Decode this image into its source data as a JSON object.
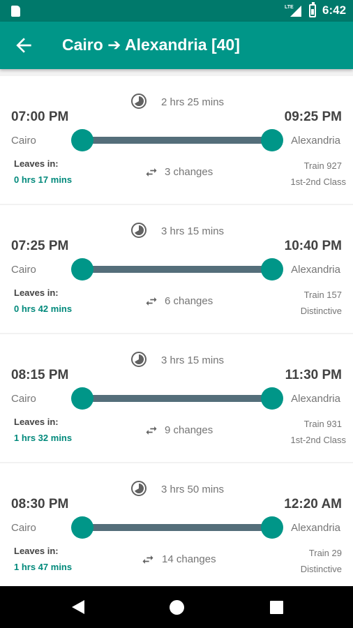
{
  "status_bar": {
    "time": "6:42",
    "network": "LTE"
  },
  "app_bar": {
    "title": "Cairo ➔ Alexandria [40]",
    "back_icon": "arrow-back-icon"
  },
  "trips": [
    {
      "duration": "2 hrs 25 mins",
      "departure_time": "07:00 PM",
      "arrival_time": "09:25 PM",
      "from": "Cairo",
      "to": "Alexandria",
      "leaves_in_label": "Leaves in:",
      "leaves_in": "0 hrs 17 mins",
      "changes": "3 changes",
      "train": "Train 927",
      "class": "1st-2nd Class"
    },
    {
      "duration": "3 hrs 15 mins",
      "departure_time": "07:25 PM",
      "arrival_time": "10:40 PM",
      "from": "Cairo",
      "to": "Alexandria",
      "leaves_in_label": "Leaves in:",
      "leaves_in": "0 hrs 42 mins",
      "changes": "6 changes",
      "train": "Train 157",
      "class": "Distinctive"
    },
    {
      "duration": "3 hrs 15 mins",
      "departure_time": "08:15 PM",
      "arrival_time": "11:30 PM",
      "from": "Cairo",
      "to": "Alexandria",
      "leaves_in_label": "Leaves in:",
      "leaves_in": "1 hrs 32 mins",
      "changes": "9 changes",
      "train": "Train 931",
      "class": "1st-2nd Class"
    },
    {
      "duration": "3 hrs 50 mins",
      "departure_time": "08:30 PM",
      "arrival_time": "12:20 AM",
      "from": "Cairo",
      "to": "Alexandria",
      "leaves_in_label": "Leaves in:",
      "leaves_in": "1 hrs 47 mins",
      "changes": "14 changes",
      "train": "Train 29",
      "class": "Distinctive"
    }
  ],
  "colors": {
    "status_bar": "#00796b",
    "app_bar": "#009688",
    "accent": "#009688",
    "route_line": "#546e7a",
    "leaves_value": "#00897b"
  },
  "nav_bar": {
    "back_icon": "nav-back-icon",
    "home_icon": "nav-home-icon",
    "recents_icon": "nav-recents-icon"
  }
}
